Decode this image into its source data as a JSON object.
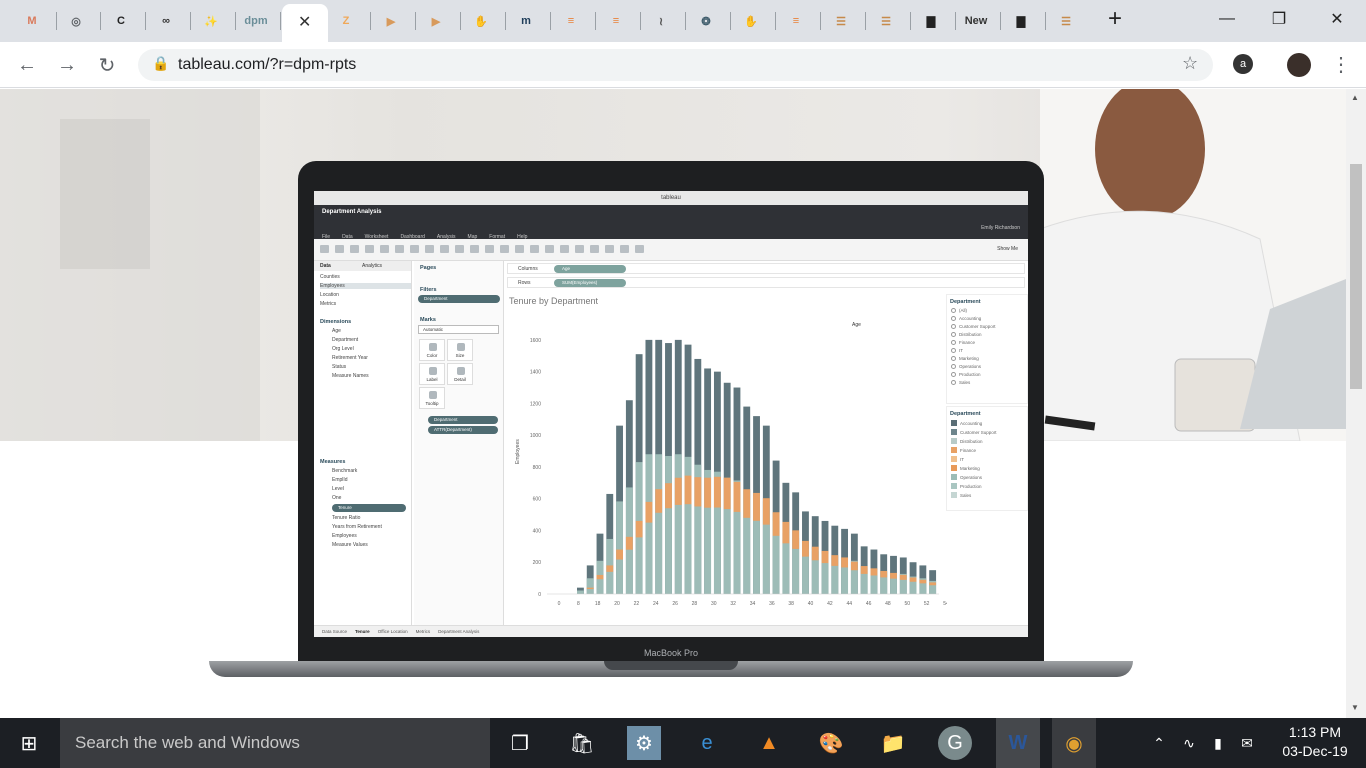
{
  "browser": {
    "tabs": [
      {
        "icon": "gmail-icon",
        "glyph": "M",
        "color": "#d97a5c"
      },
      {
        "icon": "globe-icon",
        "glyph": "◎",
        "color": "#5f6368"
      },
      {
        "icon": "cmd-icon",
        "glyph": "C",
        "color": "#222"
      },
      {
        "icon": "link-icon",
        "glyph": "∞",
        "color": "#333"
      },
      {
        "icon": "tool-icon",
        "glyph": "✨",
        "color": "#e8a267"
      },
      {
        "icon": "dpm-icon",
        "glyph": "dpm",
        "color": "#6b8e99"
      },
      {
        "icon": "zapier-icon",
        "glyph": "Z",
        "color": "#f0a858"
      },
      {
        "icon": "media-icon",
        "glyph": "▶",
        "color": "#d89a5c"
      },
      {
        "icon": "media-icon-2",
        "glyph": "▶",
        "color": "#d89a5c"
      },
      {
        "icon": "hand-icon",
        "glyph": "✋",
        "color": "#e48a45"
      },
      {
        "icon": "m-icon",
        "glyph": "m",
        "color": "#1f3d5a"
      },
      {
        "icon": "e-icon",
        "glyph": "≡",
        "color": "#e8823a"
      },
      {
        "icon": "e-icon-2",
        "glyph": "≡",
        "color": "#e8823a"
      },
      {
        "icon": "hook-icon",
        "glyph": "≀",
        "color": "#555"
      },
      {
        "icon": "swirl-icon",
        "glyph": "❂",
        "color": "#3c5a6a"
      },
      {
        "icon": "hand-icon-2",
        "glyph": "✋",
        "color": "#e48a45"
      },
      {
        "icon": "e-icon-3",
        "glyph": "≡",
        "color": "#e8823a"
      },
      {
        "icon": "lines-icon",
        "glyph": "☰",
        "color": "#c68a4a"
      },
      {
        "icon": "lines-icon-2",
        "glyph": "☰",
        "color": "#c68a4a"
      },
      {
        "icon": "bars-icon",
        "glyph": "▇",
        "color": "#222"
      },
      {
        "icon": "new-tab-label",
        "glyph": "New",
        "color": "#333"
      },
      {
        "icon": "bars-icon-2",
        "glyph": "▇",
        "color": "#222"
      },
      {
        "icon": "lines-icon-3",
        "glyph": "☰",
        "color": "#c68a4a"
      }
    ],
    "active_tab_close": "✕",
    "new_tab": "+",
    "url": "tableau.com/?r=dpm-rpts"
  },
  "tableau": {
    "window_title": "tableau",
    "workbook": "Department Analysis",
    "menu": [
      "File",
      "Data",
      "Worksheet",
      "Dashboard",
      "Analysis",
      "Map",
      "Format",
      "Help"
    ],
    "user": "Emily Richardson",
    "show_me": "Show Me",
    "data_tab": "Data",
    "analytics_tab": "Analytics",
    "sources": [
      "Counties",
      "Employees",
      "Location",
      "Metrics"
    ],
    "dimensions_header": "Dimensions",
    "dimensions": [
      "Age",
      "Department",
      "Org Level",
      "Retirement Year",
      "Status",
      "Measure Names"
    ],
    "measures_header": "Measures",
    "measures": [
      "Benchmark",
      "EmplId",
      "Level",
      "One",
      "Tenure",
      "Tenure Ratio",
      "Years from Retirement",
      "Employees",
      "Measure Values"
    ],
    "pages_label": "Pages",
    "filters_label": "Filters",
    "filter_pill": "Department",
    "marks_label": "Marks",
    "marks_type": "Automatic",
    "mark_cards": [
      "Color",
      "Size",
      "Label",
      "Detail",
      "Tooltip"
    ],
    "mark_pills": [
      "Department",
      "ATTR(Department)"
    ],
    "columns_label": "Columns",
    "columns_pill": "Age",
    "rows_label": "Rows",
    "rows_pill": "SUM(Employees)",
    "sheet_title": "Tenure by Department",
    "legend1_title": "Department",
    "legend1_items": [
      "(All)",
      "Accounting",
      "Customer Support",
      "Distribution",
      "Finance",
      "IT",
      "Marketing",
      "Operations",
      "Production",
      "Sales"
    ],
    "legend2_title": "Department",
    "legend2_items": [
      {
        "name": "Accounting",
        "color": "#5a6e76"
      },
      {
        "name": "Customer Support",
        "color": "#6d858c"
      },
      {
        "name": "Distribution",
        "color": "#b8cbc8"
      },
      {
        "name": "Finance",
        "color": "#e8a165"
      },
      {
        "name": "IT",
        "color": "#f0c08e"
      },
      {
        "name": "Marketing",
        "color": "#e89a59"
      },
      {
        "name": "Operations",
        "color": "#9cbcb6"
      },
      {
        "name": "Production",
        "color": "#a9c6c1"
      },
      {
        "name": "Sales",
        "color": "#c5d6d3"
      }
    ],
    "sheet_tabs": [
      "Data Source",
      "Tenure",
      "Office Location",
      "Metrics",
      "Department Analysis"
    ],
    "laptop_label": "MacBook Pro"
  },
  "chart_data": {
    "type": "bar",
    "title": "Tenure by Department",
    "xlabel": "Age",
    "ylabel": "Employees",
    "ylim": [
      0,
      1700
    ],
    "yticks": [
      0,
      200,
      400,
      600,
      800,
      1000,
      1200,
      1400,
      1600
    ],
    "xticks": [
      "0",
      "8",
      "18",
      "20",
      "22",
      "24",
      "26",
      "28",
      "30",
      "32",
      "34",
      "36",
      "38",
      "40",
      "42",
      "44",
      "46",
      "48",
      "50",
      "52",
      "54"
    ],
    "x": [
      18,
      19,
      20,
      21,
      22,
      23,
      24,
      25,
      26,
      27,
      28,
      29,
      30,
      31,
      32,
      33,
      34,
      35,
      36,
      37,
      38,
      39,
      40,
      41,
      42,
      43,
      44,
      45,
      46,
      47,
      48,
      49,
      50,
      51,
      52,
      53,
      54
    ],
    "series": [
      {
        "name": "Total",
        "values": [
          40,
          180,
          380,
          630,
          1060,
          1220,
          1510,
          1600,
          1600,
          1580,
          1600,
          1570,
          1480,
          1420,
          1400,
          1330,
          1300,
          1180,
          1120,
          1060,
          840,
          700,
          640,
          520,
          490,
          460,
          430,
          410,
          380,
          300,
          280,
          250,
          240,
          230,
          200,
          180,
          150
        ]
      },
      {
        "name": "Finance",
        "values": [
          0,
          20,
          60,
          90,
          140,
          180,
          230,
          290,
          330,
          350,
          380,
          400,
          410,
          420,
          430,
          440,
          420,
          400,
          390,
          370,
          330,
          300,
          260,
          220,
          190,
          170,
          150,
          140,
          120,
          110,
          100,
          90,
          80,
          70,
          60,
          50,
          40
        ]
      }
    ]
  },
  "taskbar": {
    "search_placeholder": "Search the web and Windows",
    "time": "1:13 PM",
    "date": "03-Dec-19"
  }
}
